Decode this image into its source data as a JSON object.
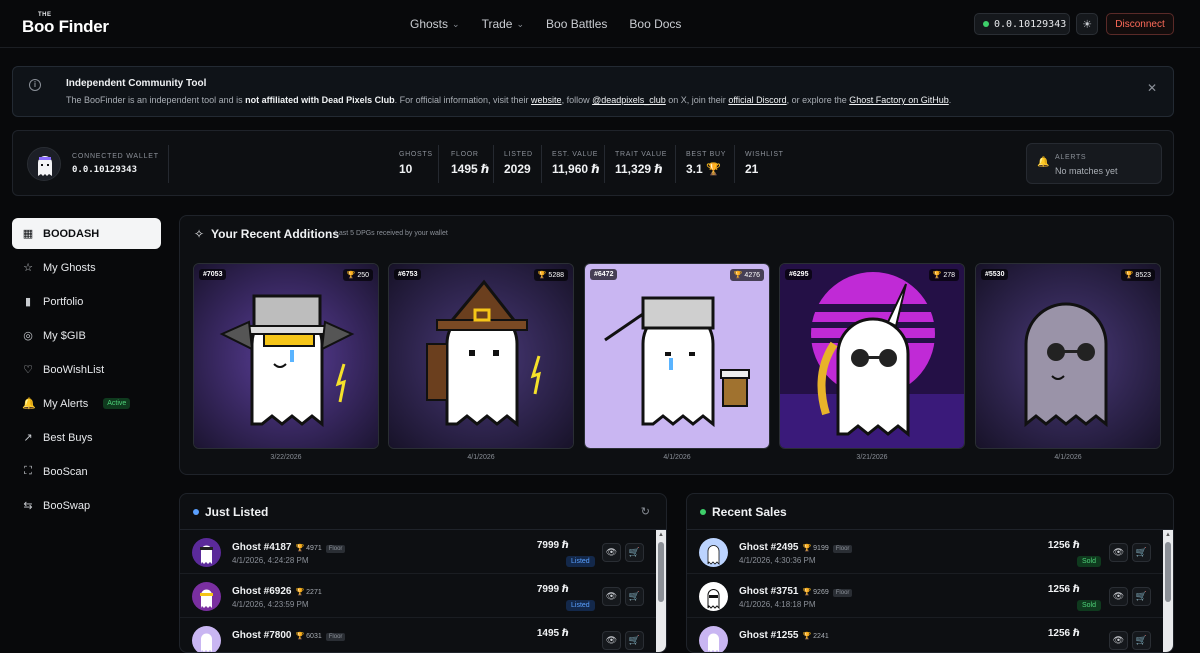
{
  "brand": {
    "the": "THE",
    "name": "Boo Finder"
  },
  "nav": [
    {
      "label": "Ghosts",
      "chevron": true
    },
    {
      "label": "Trade",
      "chevron": true
    },
    {
      "label": "Boo Battles",
      "chevron": false
    },
    {
      "label": "Boo Docs",
      "chevron": false
    }
  ],
  "header": {
    "wallet": "0.0.10129343",
    "disconnect": "Disconnect"
  },
  "notice": {
    "title": "Independent Community Tool",
    "t1": "The BooFinder is an independent tool and is ",
    "b1": "not affiliated with Dead Pixels Club",
    "t2": ". For official information, visit their ",
    "l1": "website",
    "t3": ", follow ",
    "l2": "@deadpixels_club",
    "t4": " on X, join their ",
    "l3": "official Discord",
    "t5": ", or explore the ",
    "l4": "Ghost Factory on GitHub",
    "t6": "."
  },
  "stats": {
    "connected_label": "CONNECTED WALLET",
    "connected_value": "0.0.10129343",
    "items": [
      {
        "label": "GHOSTS",
        "value": "10"
      },
      {
        "label": "FLOOR",
        "value": "1495 ℏ"
      },
      {
        "label": "LISTED",
        "value": "2029"
      },
      {
        "label": "EST. VALUE",
        "value": "11,960 ℏ"
      },
      {
        "label": "TRAIT VALUE",
        "value": "11,329 ℏ"
      },
      {
        "label": "BEST BUY",
        "value": "3.1 🏆"
      },
      {
        "label": "WISHLIST",
        "value": "21"
      }
    ],
    "alerts_label": "ALERTS",
    "alerts_value": "No matches yet"
  },
  "sidebar": [
    {
      "label": "BOODASH",
      "icon": "grid-icon",
      "glyph": "▦"
    },
    {
      "label": "My Ghosts",
      "icon": "star-icon",
      "glyph": "☆"
    },
    {
      "label": "Portfolio",
      "icon": "bar-chart-icon",
      "glyph": "▮"
    },
    {
      "label": "My $GIB",
      "icon": "coin-icon",
      "glyph": "◎"
    },
    {
      "label": "BooWishList",
      "icon": "heart-icon",
      "glyph": "♡"
    },
    {
      "label": "My Alerts",
      "icon": "bell-icon",
      "glyph": "🔔",
      "badge": "Active"
    },
    {
      "label": "Best Buys",
      "icon": "trending-icon",
      "glyph": "↗"
    },
    {
      "label": "BooScan",
      "icon": "scan-icon",
      "glyph": "⛶"
    },
    {
      "label": "BooSwap",
      "icon": "swap-icon",
      "glyph": "⇆"
    }
  ],
  "recent": {
    "title": "Your Recent Additions",
    "subtitle": "Last 5 DPGs received by your wallet",
    "cards": [
      {
        "num": "#7053",
        "rank": "250",
        "date": "3/22/2026"
      },
      {
        "num": "#6753",
        "rank": "5288",
        "date": "4/1/2026"
      },
      {
        "num": "#6472",
        "rank": "4276",
        "date": "4/1/2026"
      },
      {
        "num": "#6295",
        "rank": "278",
        "date": "3/21/2026"
      },
      {
        "num": "#5530",
        "rank": "8523",
        "date": "4/1/2026"
      }
    ]
  },
  "just_listed": {
    "title": "Just Listed",
    "rows": [
      {
        "name": "Ghost #4187",
        "rank": "4971",
        "tag": "Floor",
        "time": "4/1/2026, 4:24:28 PM",
        "price": "7999 ℏ",
        "status": "Listed"
      },
      {
        "name": "Ghost #6926",
        "rank": "2271",
        "tag": "",
        "time": "4/1/2026, 4:23:59 PM",
        "price": "7999 ℏ",
        "status": "Listed"
      },
      {
        "name": "Ghost #7800",
        "rank": "6031",
        "tag": "Floor",
        "time": "",
        "price": "1495 ℏ",
        "status": ""
      }
    ]
  },
  "recent_sales": {
    "title": "Recent Sales",
    "rows": [
      {
        "name": "Ghost #2495",
        "rank": "9199",
        "tag": "Floor",
        "time": "4/1/2026, 4:30:36 PM",
        "price": "1256 ℏ",
        "status": "Sold"
      },
      {
        "name": "Ghost #3751",
        "rank": "9269",
        "tag": "Floor",
        "time": "4/1/2026, 4:18:18 PM",
        "price": "1256 ℏ",
        "status": "Sold"
      },
      {
        "name": "Ghost #1255",
        "rank": "2241",
        "tag": "",
        "time": "",
        "price": "1256 ℏ",
        "status": ""
      }
    ]
  },
  "colors": {
    "accent": "#3ecf6a",
    "danger": "#ff6b5a",
    "listed": "#5aa0ff",
    "sold": "#4fd37a"
  }
}
